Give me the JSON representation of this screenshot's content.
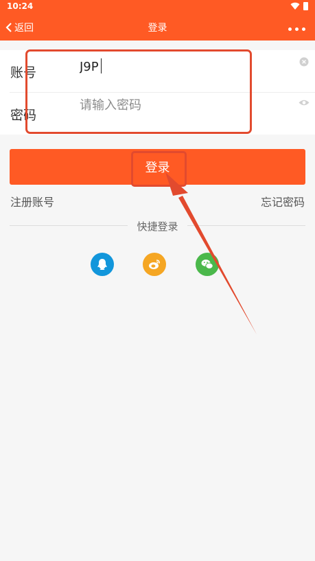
{
  "status_bar": {
    "time": "10:24"
  },
  "header": {
    "back_label": "返回",
    "title": "登录"
  },
  "form": {
    "account_label": "账号",
    "account_value": "J9P",
    "password_label": "密码",
    "password_placeholder": "请输入密码"
  },
  "login_button_label": "登录",
  "links": {
    "register": "注册账号",
    "forgot": "忘记密码"
  },
  "quick_login": {
    "label": "快捷登录",
    "providers": [
      "qq-icon",
      "weibo-icon",
      "wechat-icon"
    ]
  },
  "colors": {
    "brand": "#ff5a24",
    "annotation": "#e24a2e",
    "background": "#f6f6f6"
  }
}
